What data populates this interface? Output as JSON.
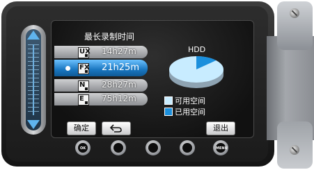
{
  "screen": {
    "title": "最长录制时间",
    "quality_rows": [
      {
        "icon": "UX",
        "time": "14h27m",
        "selected": false
      },
      {
        "icon": "FX",
        "time": "21h25m",
        "selected": true
      },
      {
        "icon": "N",
        "time": "28h27m",
        "selected": false
      },
      {
        "icon": "E",
        "time": "75h12m",
        "selected": false
      }
    ],
    "storage_label": "HDD",
    "storage_usage": {
      "used_fraction": 0.13,
      "free_fraction": 0.87
    },
    "legend": [
      {
        "label": "可用空间",
        "color": "#c8ecff"
      },
      {
        "label": "已用空间",
        "color": "#1b8fdc"
      }
    ]
  },
  "buttons": {
    "confirm": "确定",
    "back_icon": "return-arrow-icon",
    "exit": "退出"
  },
  "hardware_buttons": {
    "ok": "OK",
    "menu": "MENU"
  },
  "colors": {
    "selection": "#1f86d6",
    "used": "#1b8fdc",
    "free": "#c8ecff"
  }
}
